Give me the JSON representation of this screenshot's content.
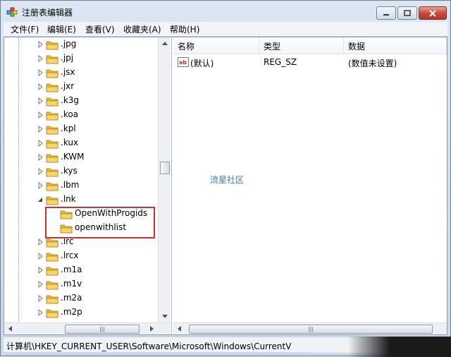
{
  "window": {
    "title": "注册表编辑器"
  },
  "menu": {
    "items": [
      {
        "label": "文件(F)"
      },
      {
        "label": "编辑(E)"
      },
      {
        "label": "查看(V)"
      },
      {
        "label": "收藏夹(A)"
      },
      {
        "label": "帮助(H)"
      }
    ]
  },
  "tree": {
    "items": [
      {
        "label": ".jpg",
        "expander": "collapsed"
      },
      {
        "label": ".jpj",
        "expander": "collapsed"
      },
      {
        "label": ".jsx",
        "expander": "collapsed"
      },
      {
        "label": ".jxr",
        "expander": "collapsed"
      },
      {
        "label": ".k3g",
        "expander": "collapsed"
      },
      {
        "label": ".koa",
        "expander": "collapsed"
      },
      {
        "label": ".kpl",
        "expander": "collapsed"
      },
      {
        "label": ".kux",
        "expander": "collapsed"
      },
      {
        "label": ".KWM",
        "expander": "collapsed"
      },
      {
        "label": ".kys",
        "expander": "collapsed"
      },
      {
        "label": ".lbm",
        "expander": "collapsed"
      },
      {
        "label": ".lnk",
        "expander": "expanded"
      },
      {
        "label": "OpenWithProgids",
        "expander": "none",
        "child": true
      },
      {
        "label": "openwithlist",
        "expander": "none",
        "child": true
      },
      {
        "label": ".lrc",
        "expander": "collapsed"
      },
      {
        "label": ".lrcx",
        "expander": "collapsed"
      },
      {
        "label": ".m1a",
        "expander": "collapsed"
      },
      {
        "label": ".m1v",
        "expander": "collapsed"
      },
      {
        "label": ".m2a",
        "expander": "collapsed"
      },
      {
        "label": ".m2p",
        "expander": "collapsed"
      }
    ]
  },
  "list": {
    "columns": [
      {
        "label": "名称"
      },
      {
        "label": "类型"
      },
      {
        "label": "数据"
      }
    ],
    "rows": [
      {
        "icon": "string-value-icon",
        "icon_text": "ab",
        "name": "(默认)",
        "type": "REG_SZ",
        "data": "(数值未设置)"
      }
    ],
    "watermark": "流星社区"
  },
  "statusbar": {
    "path": "计算机\\HKEY_CURRENT_USER\\Software\\Microsoft\\Windows\\CurrentV"
  },
  "colors": {
    "highlight_border": "#d12f2f",
    "folder": "#e8b83a",
    "watermark": "#3b7dc8"
  },
  "scrollbar_grip": "|||"
}
